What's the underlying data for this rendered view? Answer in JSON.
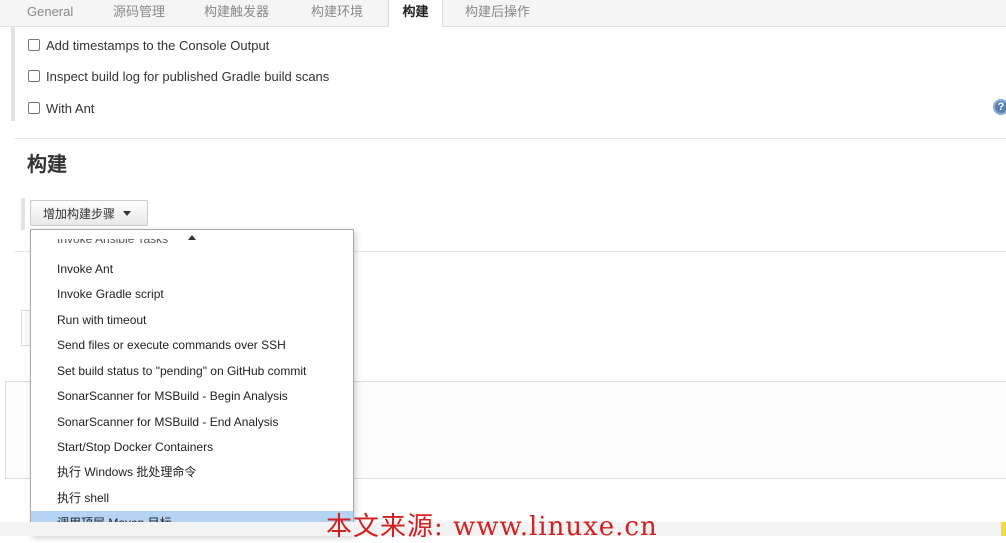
{
  "tabs": [
    {
      "label": "General"
    },
    {
      "label": "源码管理"
    },
    {
      "label": "构建触发器"
    },
    {
      "label": "构建环境"
    },
    {
      "label": "构建"
    },
    {
      "label": "构建后操作"
    }
  ],
  "active_tab": "构建",
  "build_env_options": [
    {
      "label": "Add timestamps to the Console Output",
      "checked": false
    },
    {
      "label": "Inspect build log for published Gradle build scans",
      "checked": false
    },
    {
      "label": "With Ant",
      "checked": false
    }
  ],
  "help_icon": "help-icon",
  "build_section": {
    "title": "构建",
    "add_step_label": "增加构建步骤"
  },
  "dropdown": {
    "partial_item": "Invoke Ansible Tasks",
    "items": [
      "Invoke Ant",
      "Invoke Gradle script",
      "Run with timeout",
      "Send files or execute commands over SSH",
      "Set build status to \"pending\" on GitHub commit",
      "SonarScanner for MSBuild - Begin Analysis",
      "SonarScanner for MSBuild - End Analysis",
      "Start/Stop Docker Containers",
      "执行 Windows 批处理命令",
      "执行 shell",
      "调用顶层 Maven 目标"
    ],
    "highlighted": "调用顶层 Maven 目标"
  },
  "watermark": "本文来源: www.linuxe.cn",
  "colors": {
    "highlight": "#b5d3f3",
    "watermark": "#d32020",
    "tab_bg": "#f5f5f5"
  }
}
